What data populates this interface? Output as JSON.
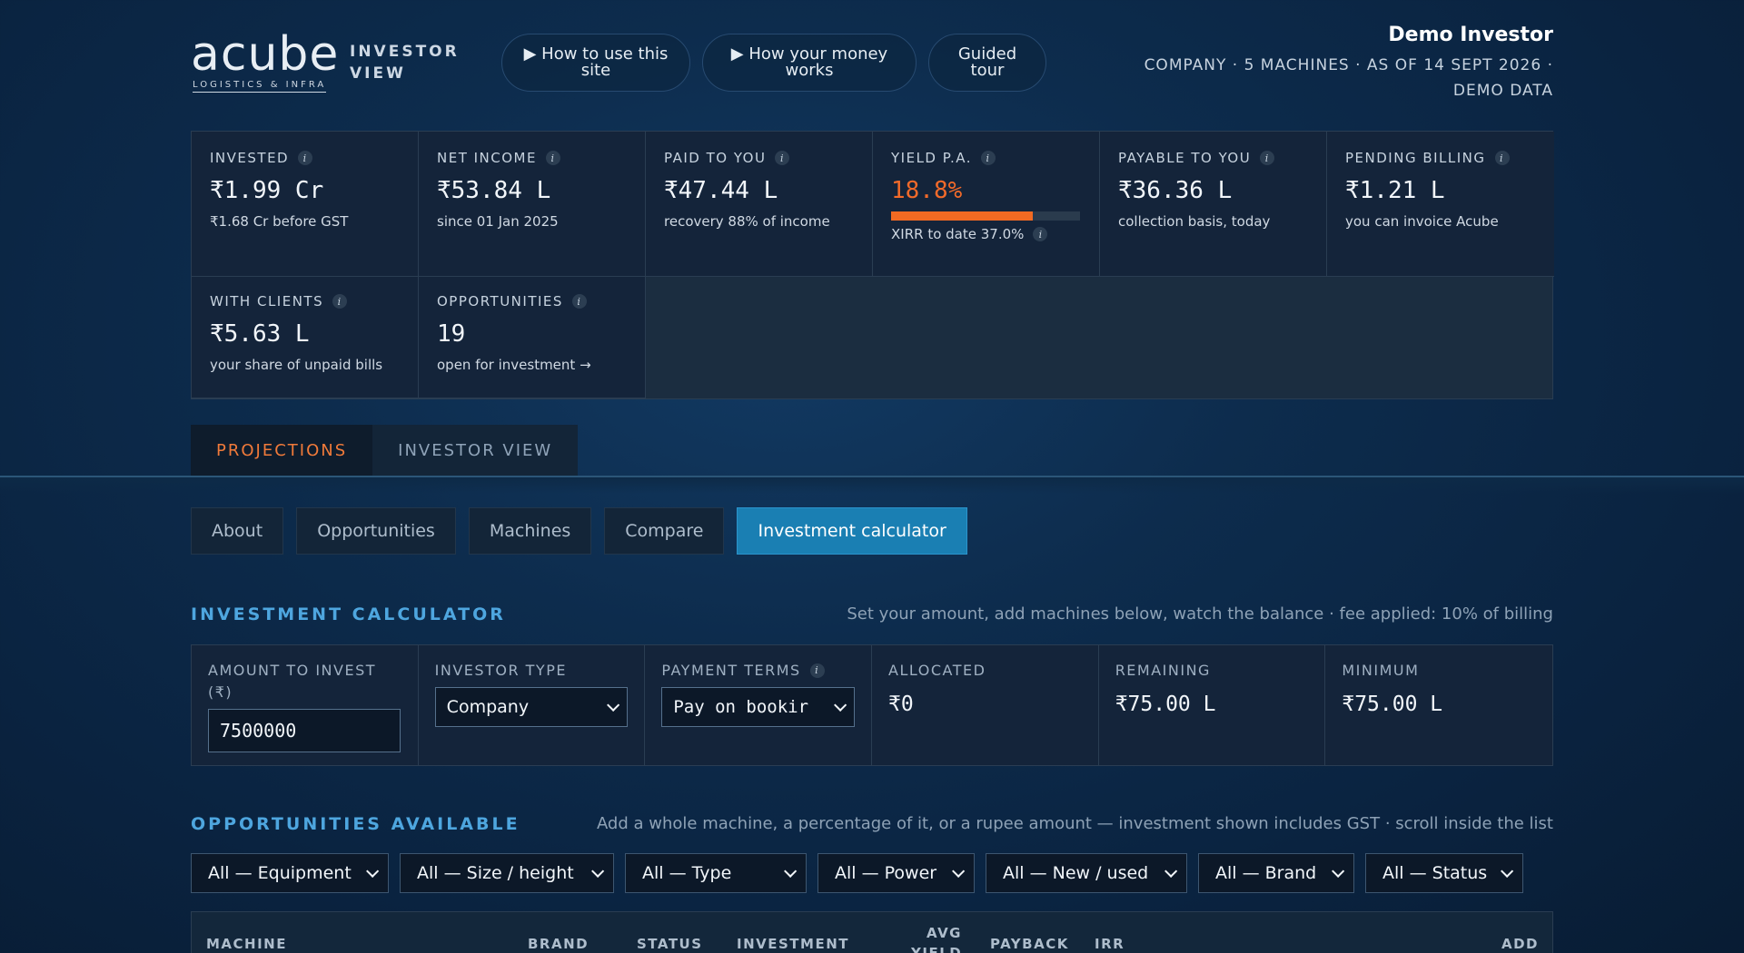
{
  "header": {
    "logo_word": "acube",
    "logo_sub": "LOGISTICS & INFRA",
    "view_label": "INVESTOR VIEW",
    "buttons": {
      "how_to": "▶ How to use this site",
      "money": "▶ How your money works",
      "tour": "Guided tour"
    },
    "investor_name": "Demo Investor",
    "investor_meta": "COMPANY · 5 MACHINES · AS OF 14 SEPT 2026 · DEMO DATA"
  },
  "stats": {
    "invested": {
      "label": "INVESTED",
      "value": "₹1.99 Cr",
      "sub": "₹1.68 Cr before GST"
    },
    "net_income": {
      "label": "NET INCOME",
      "value": "₹53.84 L",
      "sub": "since 01 Jan 2025"
    },
    "paid": {
      "label": "PAID TO YOU",
      "value": "₹47.44 L",
      "sub": "recovery 88% of income"
    },
    "yield": {
      "label": "YIELD P.A.",
      "value": "18.8%",
      "sub": "XIRR to date 37.0%",
      "bar_fraction": 0.75
    },
    "payable": {
      "label": "PAYABLE TO YOU",
      "value": "₹36.36 L",
      "sub": "collection basis, today"
    },
    "pending": {
      "label": "PENDING BILLING",
      "value": "₹1.21 L",
      "sub": "you can invoice Acube"
    },
    "clients": {
      "label": "WITH CLIENTS",
      "value": "₹5.63 L",
      "sub": "your share of unpaid bills"
    },
    "opps": {
      "label": "OPPORTUNITIES",
      "value": "19",
      "sub": "open for investment →"
    }
  },
  "main_tabs": {
    "projections": "PROJECTIONS",
    "investor_view": "INVESTOR VIEW"
  },
  "sub_tabs": {
    "about": "About",
    "opportunities": "Opportunities",
    "machines": "Machines",
    "compare": "Compare",
    "calculator": "Investment calculator"
  },
  "calculator": {
    "title": "INVESTMENT CALCULATOR",
    "note": "Set your amount, add machines below, watch the balance · fee applied: 10% of billing",
    "amount_label": "AMOUNT TO INVEST (₹)",
    "amount_value": "7500000",
    "investor_type_label": "INVESTOR TYPE",
    "investor_type_value": "Company",
    "payment_terms_label": "PAYMENT TERMS",
    "payment_terms_value": "Pay on bookir",
    "allocated_label": "ALLOCATED",
    "allocated_value": "₹0",
    "remaining_label": "REMAINING",
    "remaining_value": "₹75.00 L",
    "minimum_label": "MINIMUM",
    "minimum_value": "₹75.00 L"
  },
  "opportunities": {
    "title": "OPPORTUNITIES AVAILABLE",
    "note": "Add a whole machine, a percentage of it, or a rupee amount — investment shown includes GST · scroll inside the list",
    "filters": {
      "equipment": "All — Equipment",
      "size": "All — Size / height",
      "type": "All — Type",
      "power": "All — Power",
      "condition": "All — New / used",
      "brand": "All — Brand",
      "status": "All — Status"
    },
    "columns": {
      "machine": "MACHINE",
      "brand": "BRAND",
      "status": "STATUS",
      "investment": "INVESTMENT",
      "avg_yield": "AVG YIELD",
      "payback": "PAYBACK",
      "irr": "IRR",
      "add": "ADD"
    }
  }
}
